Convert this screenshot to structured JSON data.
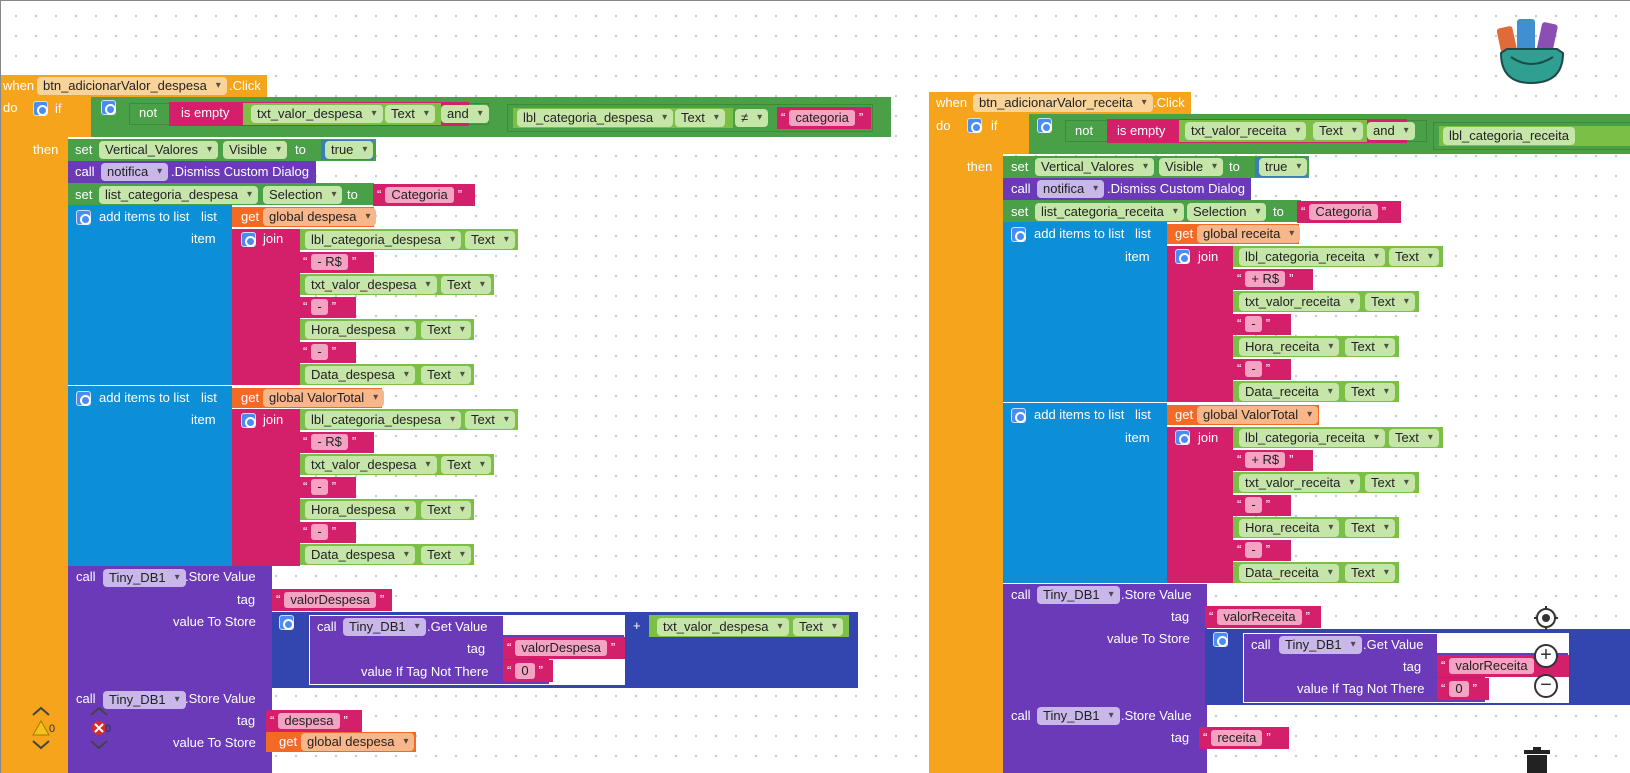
{
  "event_left": {
    "when": "when",
    "component": "btn_adicionarValor_despesa",
    "event": ".Click",
    "do": "do",
    "if": "if",
    "not": "not",
    "is_empty": "is empty",
    "txt_field": "txt_valor_despesa",
    "text": "Text",
    "and": "and",
    "lbl_field": "lbl_categoria_despesa",
    "neq": "≠",
    "categoria": "categoria",
    "then": "then",
    "set": "set",
    "vertical": "Vertical_Valores",
    "visible": "Visible",
    "to": "to",
    "true": "true",
    "call": "call",
    "notifica": "notifica",
    "dismiss": ".Dismiss Custom Dialog",
    "list_categoria": "list_categoria_despesa",
    "selection": "Selection",
    "categoria_cap": "Categoria",
    "add_items": "add items to list",
    "list": "list",
    "item": "item",
    "get": "get",
    "global_list": "global despesa",
    "global_total": "global ValorTotal",
    "join": "join",
    "sep_rs": "- R$",
    "dash": "-",
    "hora": "Hora_despesa",
    "data": "Data_despesa",
    "tinydb": "Tiny_DB1",
    "store_value": ".Store Value",
    "tag": "tag",
    "value_to_store": "value To Store",
    "valor_tag": "valorDespesa",
    "get_value": ".Get Value",
    "value_if_not_there": "value If Tag Not There",
    "zero": "0",
    "plus": "+",
    "tag2": "despesa"
  },
  "event_right": {
    "when": "when",
    "component": "btn_adicionarValor_receita",
    "event": ".Click",
    "do": "do",
    "if": "if",
    "not": "not",
    "is_empty": "is empty",
    "txt_field": "txt_valor_receita",
    "text": "Text",
    "and": "and",
    "lbl_field": "lbl_categoria_receita",
    "then": "then",
    "set": "set",
    "vertical": "Vertical_Valores",
    "visible": "Visible",
    "to": "to",
    "true": "true",
    "call": "call",
    "notifica": "notifica",
    "dismiss": ".Dismiss Custom Dialog",
    "list_categoria": "list_categoria_receita",
    "selection": "Selection",
    "categoria_cap": "Categoria",
    "add_items": "add items to list",
    "list": "list",
    "item": "item",
    "get": "get",
    "global_list": "global receita",
    "global_total": "global ValorTotal",
    "join": "join",
    "sep_rs": "+ R$",
    "dash": "-",
    "hora": "Hora_receita",
    "data": "Data_receita",
    "tinydb": "Tiny_DB1",
    "store_value": ".Store Value",
    "tag": "tag",
    "value_to_store": "value To Store",
    "valor_tag": "valorReceita",
    "get_value": ".Get Value",
    "value_if_not_there": "value If Tag Not There",
    "zero": "0",
    "plus": "+",
    "tag2": "receita"
  },
  "status": {
    "warnings": "0",
    "errors": "0"
  },
  "workspace_controls": {
    "zoom_in": "+",
    "zoom_out": "−"
  }
}
